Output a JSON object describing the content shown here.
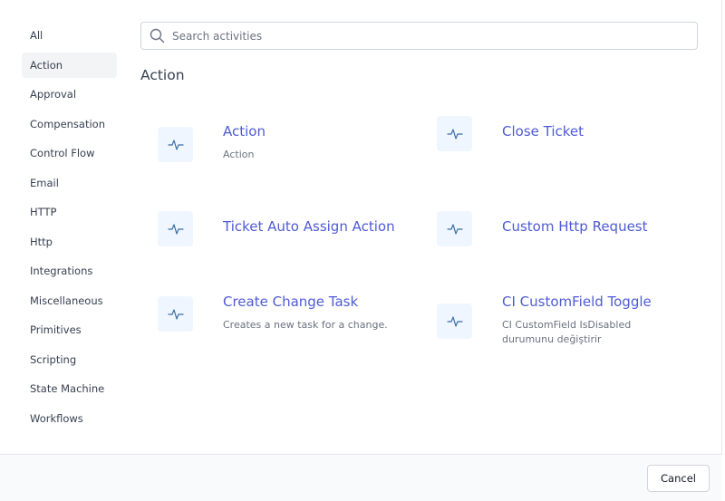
{
  "sidebar": {
    "items": [
      {
        "label": "All"
      },
      {
        "label": "Action"
      },
      {
        "label": "Approval"
      },
      {
        "label": "Compensation"
      },
      {
        "label": "Control Flow"
      },
      {
        "label": "Email"
      },
      {
        "label": "HTTP"
      },
      {
        "label": "Http"
      },
      {
        "label": "Integrations"
      },
      {
        "label": "Miscellaneous"
      },
      {
        "label": "Primitives"
      },
      {
        "label": "Scripting"
      },
      {
        "label": "State Machine"
      },
      {
        "label": "Workflows"
      }
    ],
    "active_label": "Action"
  },
  "search": {
    "placeholder": "Search activities",
    "value": ""
  },
  "section": {
    "title": "Action"
  },
  "activities": [
    {
      "title": "Action",
      "description": "Action",
      "icon": "activity-icon"
    },
    {
      "title": "Close Ticket",
      "description": "",
      "icon": "activity-icon"
    },
    {
      "title": "Ticket Auto Assign Action",
      "description": "",
      "icon": "activity-icon"
    },
    {
      "title": "Custom Http Request",
      "description": "",
      "icon": "activity-icon"
    },
    {
      "title": "Create Change Task",
      "description": "Creates a new task for a change.",
      "icon": "activity-icon"
    },
    {
      "title": "CI CustomField Toggle",
      "description": "CI CustomField IsDisabled durumunu değiştirir",
      "icon": "activity-icon"
    }
  ],
  "footer": {
    "cancel_label": "Cancel"
  },
  "colors": {
    "accent": "#4f5bd5",
    "tile_bg": "#eff6ff",
    "active_bg": "#f3f4f6"
  }
}
